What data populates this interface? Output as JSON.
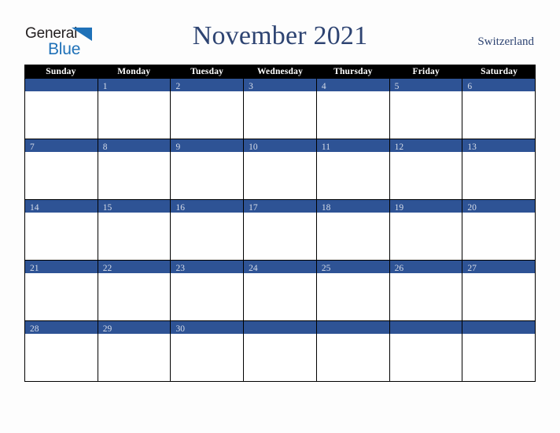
{
  "logo": {
    "word_one": "General",
    "word_two": "Blue",
    "triangle_color": "#1f71b8",
    "word_one_color": "#231f20"
  },
  "header": {
    "title": "November 2021",
    "country": "Switzerland",
    "title_color": "#2e4472"
  },
  "calendar": {
    "day_headers": [
      "Sunday",
      "Monday",
      "Tuesday",
      "Wednesday",
      "Thursday",
      "Friday",
      "Saturday"
    ],
    "header_bg": "#000000",
    "header_text_color": "#ffffff",
    "date_bar_color": "#2e5395",
    "date_text_color": "#d6dce8",
    "cell_bg": "#ffffff",
    "weeks": [
      [
        "",
        "1",
        "2",
        "3",
        "4",
        "5",
        "6"
      ],
      [
        "7",
        "8",
        "9",
        "10",
        "11",
        "12",
        "13"
      ],
      [
        "14",
        "15",
        "16",
        "17",
        "18",
        "19",
        "20"
      ],
      [
        "21",
        "22",
        "23",
        "24",
        "25",
        "26",
        "27"
      ],
      [
        "28",
        "29",
        "30",
        "",
        "",
        "",
        ""
      ]
    ]
  }
}
